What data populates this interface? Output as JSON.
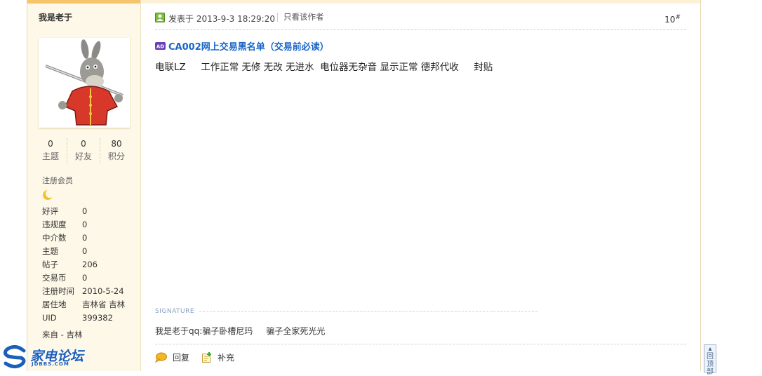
{
  "author": {
    "username": "我是老于",
    "stats": [
      {
        "value": "0",
        "label": "主题"
      },
      {
        "value": "0",
        "label": "好友"
      },
      {
        "value": "80",
        "label": "积分"
      }
    ],
    "group": "注册会员",
    "group_icon": "crescent-moon-icon",
    "info": [
      {
        "key": "好评",
        "value": "0"
      },
      {
        "key": "违规度",
        "value": "0"
      },
      {
        "key": "中介数",
        "value": "0"
      },
      {
        "key": "主题",
        "value": "0"
      },
      {
        "key": "帖子",
        "value": "206"
      },
      {
        "key": "交易币",
        "value": "0"
      },
      {
        "key": "注册时间",
        "value": "2010-5-24"
      },
      {
        "key": "居住地",
        "value": "吉林省 吉林"
      },
      {
        "key": "UID",
        "value": "399382"
      }
    ],
    "origin": "来自 - 吉林"
  },
  "post": {
    "posted_label": "发表于 2013-9-3 18:29:20",
    "only_author": "只看该作者",
    "floor": "10",
    "floor_mark": "#",
    "ad_badge": "AD",
    "ad_link": "CA002网上交易黑名单（交易前必读）",
    "content": "电联LZ     工作正常 无修 无改 无进水  电位器无杂音 显示正常 德邦代收     封贴",
    "signature_label": "SIGNATURE",
    "signature": "我是老于qq:骗子卧槽尼玛     骗子全家死光光"
  },
  "actions": {
    "reply": "回复",
    "supplement": "补充"
  },
  "back_to_top": "回顶部",
  "logo": {
    "name": "家电论坛",
    "domain": "JDBBS.COM"
  },
  "colors": {
    "sidebar_bg": "#fdf8e8",
    "accent_orange": "#f6c46a",
    "link_blue": "#1a66c9"
  }
}
